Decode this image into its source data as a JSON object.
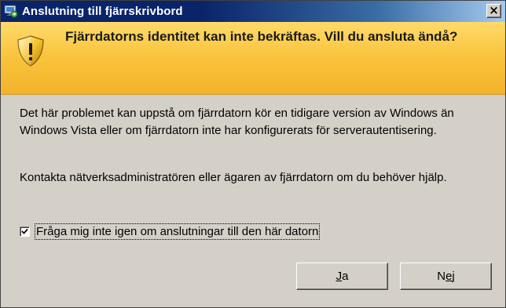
{
  "window": {
    "title": "Anslutning till fjärrskrivbord",
    "close_glyph": "×"
  },
  "banner": {
    "icon": "security-warning-shield-icon",
    "message": "Fjärrdatorns identitet kan inte bekräftas. Vill du ansluta ändå?"
  },
  "body": {
    "paragraph1": "Det här problemet kan uppstå om fjärrdatorn kör en tidigare version av Windows än Windows Vista eller om fjärrdatorn inte har konfigurerats för serverautentisering.",
    "paragraph2": "Kontakta nätverksadministratören eller ägaren av fjärrdatorn om du behöver hjälp."
  },
  "checkbox": {
    "label": "Fråga mig inte igen om anslutningar till den här datorn",
    "checked": true
  },
  "buttons": {
    "yes": {
      "label": "Ja",
      "mnemonic": "J",
      "rest": "a"
    },
    "no": {
      "label": "Nej",
      "prefix": "N",
      "mnemonic": "e",
      "rest": "j"
    }
  },
  "colors": {
    "titlebar": "#0a246a",
    "banner": "#f9c33b",
    "dialog": "#d4d0c8"
  }
}
